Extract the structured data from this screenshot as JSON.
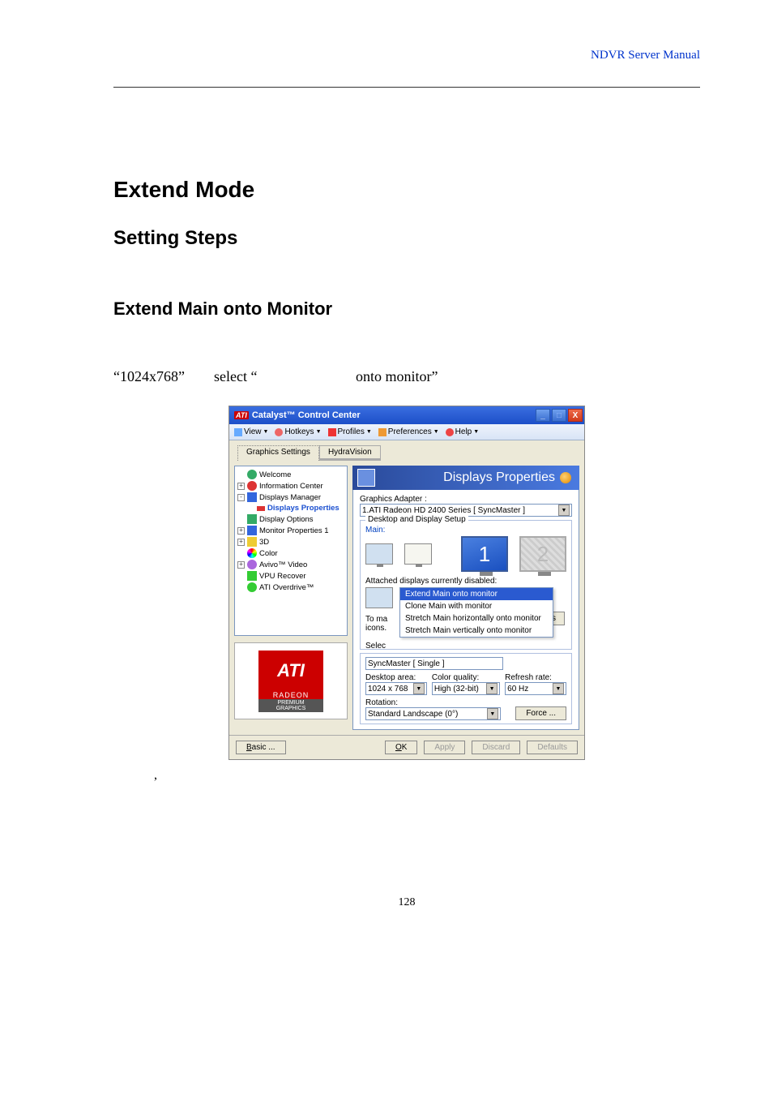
{
  "header": {
    "manual_title": "NDVR Server Manual"
  },
  "doc": {
    "h1": "Extend Mode",
    "h2": "Setting Steps",
    "h3": "Extend Main onto Monitor",
    "line_open": "“1024x768”",
    "line_mid": "select “",
    "line_end": "onto monitor”",
    "comma": ",",
    "page_num": "128"
  },
  "win": {
    "title_prefix": "ATI",
    "title": "Catalyst™ Control Center",
    "menu": [
      "View",
      "Hotkeys",
      "Profiles",
      "Preferences",
      "Help"
    ],
    "tabs": {
      "active": "Graphics Settings",
      "inactive": "HydraVision"
    },
    "tree": {
      "welcome": "Welcome",
      "info": "Information Center",
      "dispmgr": "Displays Manager",
      "dispprop": "Displays Properties",
      "dispopt": "Display Options",
      "monprop": "Monitor Properties 1",
      "threeD": "3D",
      "color": "Color",
      "avivo": "Avivo™ Video",
      "vpu": "VPU Recover",
      "overdrive": "ATI Overdrive™"
    },
    "logo": {
      "brand": "ATI",
      "line1": "RADEON",
      "line2": "PREMIUM\nGRAPHICS"
    },
    "panel": {
      "title": "Displays Properties",
      "adapter_label": "Graphics Adapter :",
      "adapter_value": "1.ATI Radeon HD 2400 Series [ SyncMaster ]",
      "group_title": "Desktop and Display Setup",
      "main_label": "Main:",
      "mon1": "1",
      "mon2": "2",
      "attached": "Attached displays currently disabled:",
      "ctx": {
        "i1": "Extend Main onto monitor",
        "i2": "Clone Main with monitor",
        "i3": "Stretch Main horizontally onto monitor",
        "i4": "Stretch Main vertically onto monitor"
      },
      "hint1": "To ma",
      "hint2": "icons.",
      "hint3": "Selec",
      "detect": "Detect Displays",
      "selected_dev": "SyncMaster [ Single ]",
      "desktop_area_label": "Desktop area:",
      "desktop_area": "1024 x 768",
      "color_label": "Color quality:",
      "color": "High (32-bit)",
      "refresh_label": "Refresh rate:",
      "refresh": "60 Hz",
      "rotation_label": "Rotation:",
      "rotation": "Standard Landscape (0°)",
      "force": "Force ..."
    },
    "buttons": {
      "basic": "Basic ...",
      "ok": "OK",
      "apply": "Apply",
      "discard": "Discard",
      "defaults": "Defaults"
    }
  }
}
